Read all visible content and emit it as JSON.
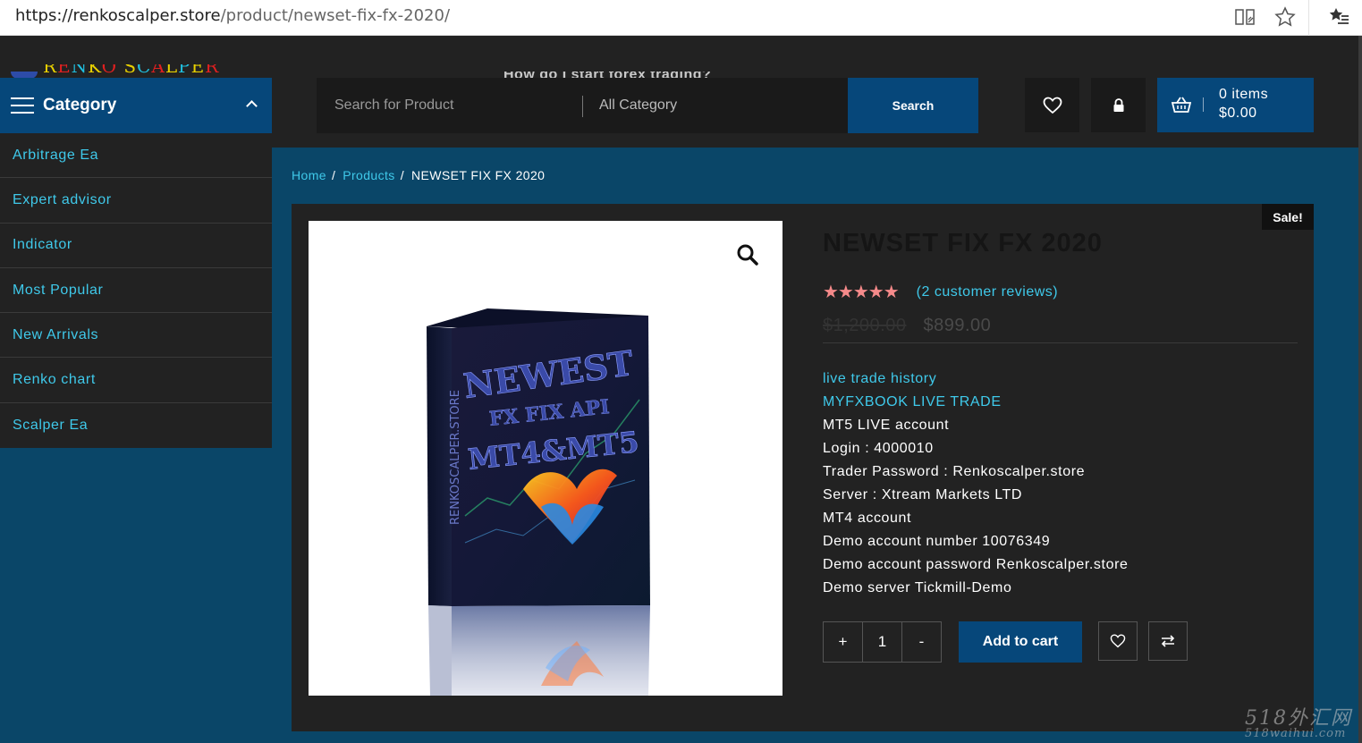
{
  "browser": {
    "url_host": "https://renkoscalper.store",
    "url_path": "/product/newset-fix-fx-2020/"
  },
  "header": {
    "logo_text": "RENKO SCALPER",
    "tagline": "How do I start forex trading?",
    "category_label": "Category",
    "search_placeholder": "Search for Product",
    "search_category": "All Category",
    "search_button": "Search",
    "cart_items": "0 items",
    "cart_total": "$0.00"
  },
  "sidebar": {
    "items": [
      {
        "label": "Arbitrage Ea"
      },
      {
        "label": "Expert advisor"
      },
      {
        "label": "Indicator"
      },
      {
        "label": "Most Popular"
      },
      {
        "label": "New Arrivals"
      },
      {
        "label": "Renko chart"
      },
      {
        "label": "Scalper Ea"
      }
    ]
  },
  "breadcrumb": {
    "home": "Home",
    "products": "Products",
    "current": "NEWSET FIX FX 2020",
    "sep": "/"
  },
  "product": {
    "sale_badge": "Sale!",
    "title": "NEWSET FIX FX 2020",
    "rating": 5,
    "stars": "★★★★★",
    "reviews": "(2 customer reviews)",
    "price_old": "$1,200.00",
    "price_new": "$899.00",
    "description": [
      {
        "text": "live trade history",
        "link": true
      },
      {
        "text": "MYFXBOOK LIVE TRADE",
        "link": true
      },
      {
        "text": "MT5 LIVE account",
        "link": false
      },
      {
        "text": "Login : 4000010",
        "link": false
      },
      {
        "text": "Trader Password : Renkoscalper.store",
        "link": false
      },
      {
        "text": "Server : Xtream Markets LTD",
        "link": false
      },
      {
        "text": "MT4 account",
        "link": false
      },
      {
        "text": "Demo account number 10076349",
        "link": false
      },
      {
        "text": "Demo account password Renkoscalper.store",
        "link": false
      },
      {
        "text": "Demo server Tickmill-Demo",
        "link": false
      }
    ],
    "qty_plus": "+",
    "qty_value": "1",
    "qty_minus": "-",
    "add_to_cart": "Add to cart",
    "box_art": {
      "title": "NEWEST",
      "subtitle": "FX FIX API",
      "platforms": "MT4&MT5",
      "side_text": "RENKOSCALPER.STORE"
    }
  },
  "watermark": {
    "line1": "518外汇网",
    "line2": "518waihui.com"
  },
  "colors": {
    "accent_blue": "#06477a",
    "link_cyan": "#3fc9ea",
    "page_bg": "#0a4668",
    "panel_bg": "#222222",
    "star": "#f58a8a"
  }
}
